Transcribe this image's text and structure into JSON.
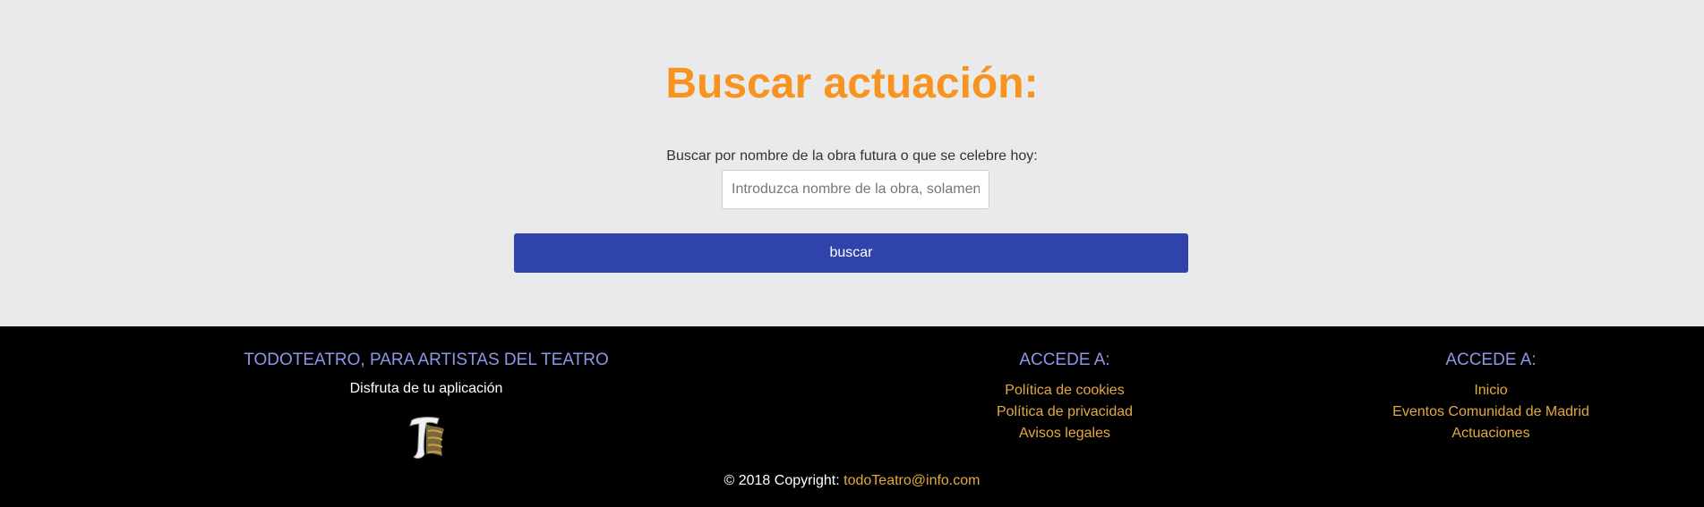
{
  "search": {
    "title": "Buscar actuación:",
    "label": "Buscar por nombre de la obra futura o que se celebre hoy:",
    "placeholder": "Introduzca nombre de la obra, solamente",
    "button_label": "buscar"
  },
  "footer": {
    "brand_heading": "TODOTEATRO, PARA ARTISTAS DEL TEATRO",
    "tagline": "Disfruta de tu aplicación",
    "col2": {
      "heading": "ACCEDE A:",
      "links": [
        "Política de cookies",
        "Política de privacidad",
        "Avisos legales"
      ]
    },
    "col3": {
      "heading": "ACCEDE A:",
      "links": [
        "Inicio",
        "Eventos Comunidad de Madrid",
        "Actuaciones"
      ]
    },
    "copyright_prefix": "© 2018 Copyright:",
    "copyright_email": "todoTeatro@info.com"
  },
  "colors": {
    "accent_orange": "#f7931e",
    "button_blue": "#2f43aa",
    "footer_heading": "#8f95e8",
    "footer_link": "#e5a93d"
  }
}
